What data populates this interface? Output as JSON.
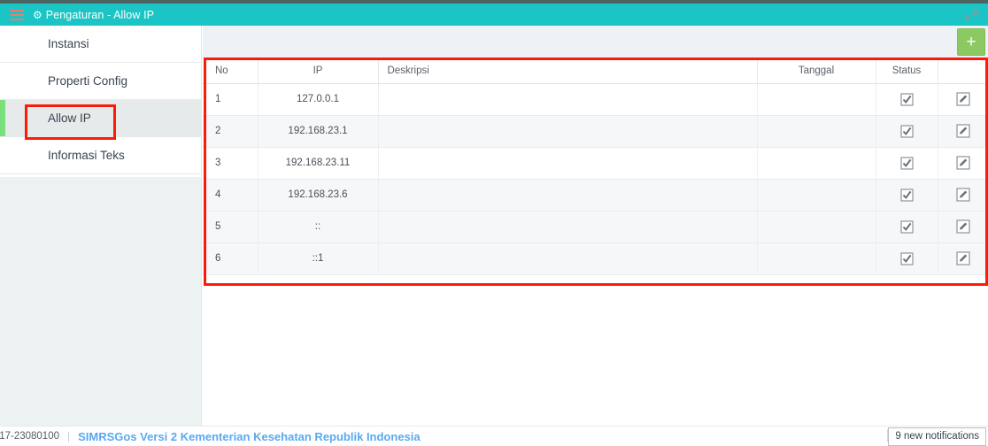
{
  "window": {
    "title": "Pengaturan - Allow IP",
    "menu_icon": "hamburger-icon",
    "title_icon": "gear-icon",
    "expand_icon": "expand-arrows-icon",
    "header_color": "#1cc5c5",
    "top_strip_color": "#4c6461"
  },
  "sidebar": {
    "items": [
      {
        "label": "Instansi",
        "active": false
      },
      {
        "label": "Properti Config",
        "active": false
      },
      {
        "label": "Allow IP",
        "active": true
      },
      {
        "label": "Informasi Teks",
        "active": false
      }
    ],
    "active_accent_color": "#79e07b"
  },
  "toolbar": {
    "add_label": "+",
    "add_icon": "plus-icon",
    "add_color": "#8dc963"
  },
  "table": {
    "columns": [
      "No",
      "IP",
      "Deskripsi",
      "Tanggal",
      "Status",
      ""
    ],
    "rows": [
      {
        "no": "1",
        "ip": "127.0.0.1",
        "deskripsi": "",
        "tanggal": "",
        "status": "checked",
        "action": "edit"
      },
      {
        "no": "2",
        "ip": "192.168.23.1",
        "deskripsi": "",
        "tanggal": "",
        "status": "checked",
        "action": "edit"
      },
      {
        "no": "3",
        "ip": "192.168.23.11",
        "deskripsi": "",
        "tanggal": "",
        "status": "checked",
        "action": "edit"
      },
      {
        "no": "4",
        "ip": "192.168.23.6",
        "deskripsi": "",
        "tanggal": "",
        "status": "checked",
        "action": "edit"
      },
      {
        "no": "5",
        "ip": "::",
        "deskripsi": "",
        "tanggal": "",
        "status": "checked",
        "action": "edit"
      },
      {
        "no": "6",
        "ip": "::1",
        "deskripsi": "",
        "tanggal": "",
        "status": "checked",
        "action": "edit"
      }
    ],
    "status_icon": "checkbox-checked-icon",
    "action_icon": "edit-pencil-icon"
  },
  "annotations": {
    "highlight_color": "#fb1b08",
    "boxes": [
      "sidebar-allow-ip",
      "ip-table"
    ]
  },
  "footer": {
    "version": ".17-23080100",
    "separator": "|",
    "brand": "SIMRSGos Versi 2 Kementerian Kesehatan Republik Indonesia",
    "notifications": "9 new notifications"
  }
}
